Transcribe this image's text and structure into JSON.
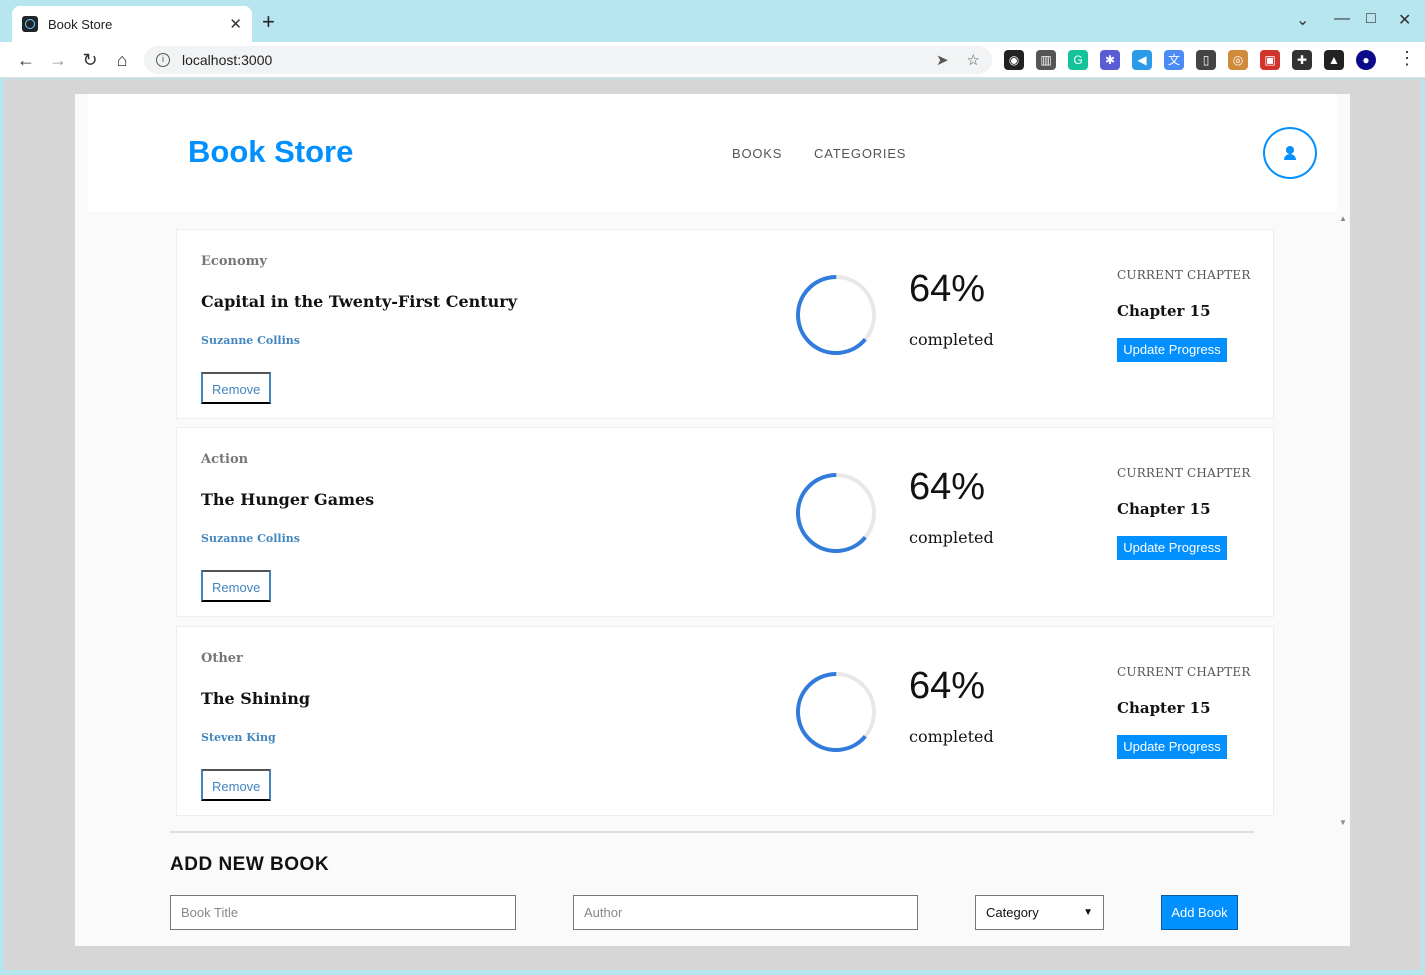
{
  "browser": {
    "tab_title": "Book Store",
    "tab_close": "✕",
    "new_tab": "+",
    "url": "localhost:3000",
    "window_controls": [
      "⌄",
      "—",
      "□",
      "✕"
    ],
    "extensions": [
      {
        "icon": "rss-icon",
        "color": "#222222",
        "glyph": "◉"
      },
      {
        "icon": "library-icon",
        "color": "#555555",
        "glyph": "▥"
      },
      {
        "icon": "grammarly-icon",
        "color": "#15c39a",
        "glyph": "G"
      },
      {
        "icon": "asterisk-icon",
        "color": "#5b5bd6",
        "glyph": "✱"
      },
      {
        "icon": "clickup-icon",
        "color": "#2b9ae8",
        "glyph": "◀"
      },
      {
        "icon": "translate-icon",
        "color": "#4a8bf5",
        "glyph": "文"
      },
      {
        "icon": "bookmark-icon",
        "color": "#444444",
        "glyph": "▯"
      },
      {
        "icon": "owl-icon",
        "color": "#d08a3c",
        "glyph": "◎"
      },
      {
        "icon": "gallery-icon",
        "color": "#d0342c",
        "glyph": "▣"
      },
      {
        "icon": "puzzle-icon",
        "color": "#333333",
        "glyph": "✚"
      },
      {
        "icon": "flask-icon",
        "color": "#222222",
        "glyph": "▲"
      },
      {
        "icon": "profile-icon",
        "color": "#0a0a8a",
        "glyph": "●"
      }
    ]
  },
  "header": {
    "logo": "Book Store",
    "nav": [
      "BOOKS",
      "CATEGORIES"
    ]
  },
  "books": [
    {
      "category": "Economy",
      "title": "Capital in the Twenty-First Century",
      "author": "Suzanne Collins",
      "remove_label": "Remove",
      "percent": "64%",
      "progress": 0.64,
      "completed_label": "completed",
      "chapter_label": "CURRENT CHAPTER",
      "chapter": "Chapter 15",
      "update_label": "Update Progress"
    },
    {
      "category": "Action",
      "title": "The Hunger Games",
      "author": "Suzanne Collins",
      "remove_label": "Remove",
      "percent": "64%",
      "progress": 0.64,
      "completed_label": "completed",
      "chapter_label": "CURRENT CHAPTER",
      "chapter": "Chapter 15",
      "update_label": "Update Progress"
    },
    {
      "category": "Other",
      "title": "The Shining",
      "author": "Steven King",
      "remove_label": "Remove",
      "percent": "64%",
      "progress": 0.64,
      "completed_label": "completed",
      "chapter_label": "CURRENT CHAPTER",
      "chapter": "Chapter 15",
      "update_label": "Update Progress"
    }
  ],
  "add_form": {
    "heading": "ADD NEW BOOK",
    "title_placeholder": "Book Title",
    "author_placeholder": "Author",
    "category_selected": "Category",
    "submit_label": "Add Book"
  },
  "colors": {
    "accent": "#0290ff",
    "ring": "#307bdb",
    "ring_track": "#e8e8e8"
  }
}
